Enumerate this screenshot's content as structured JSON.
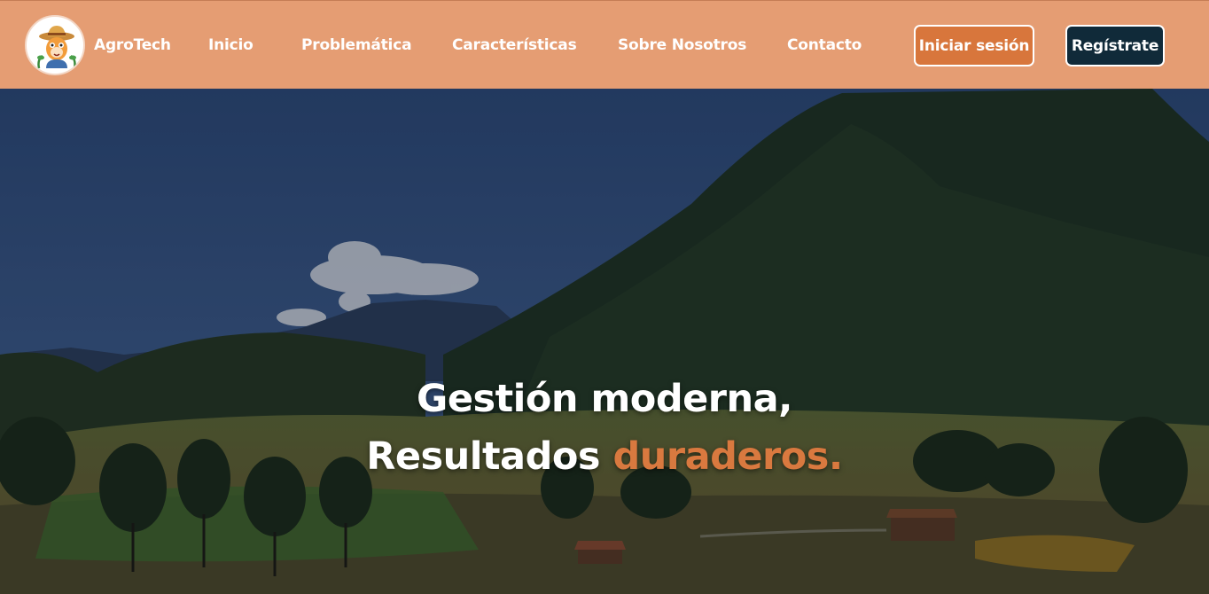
{
  "brand": {
    "name": "AgroTech",
    "logo_icon": "farmer-mascot-icon"
  },
  "nav": {
    "links": [
      "Inicio",
      "Problemática",
      "Características",
      "Sobre Nosotros",
      "Contacto"
    ],
    "login_label": "Iniciar sesión",
    "register_label": "Regístrate"
  },
  "hero": {
    "line1": "Gestión moderna,",
    "line2_main": "Resultados ",
    "line2_accent": "duraderos."
  },
  "colors": {
    "navbar": "#e59d73",
    "login_button": "#d8763c",
    "register_button": "#102a39",
    "accent": "#d9793f"
  }
}
